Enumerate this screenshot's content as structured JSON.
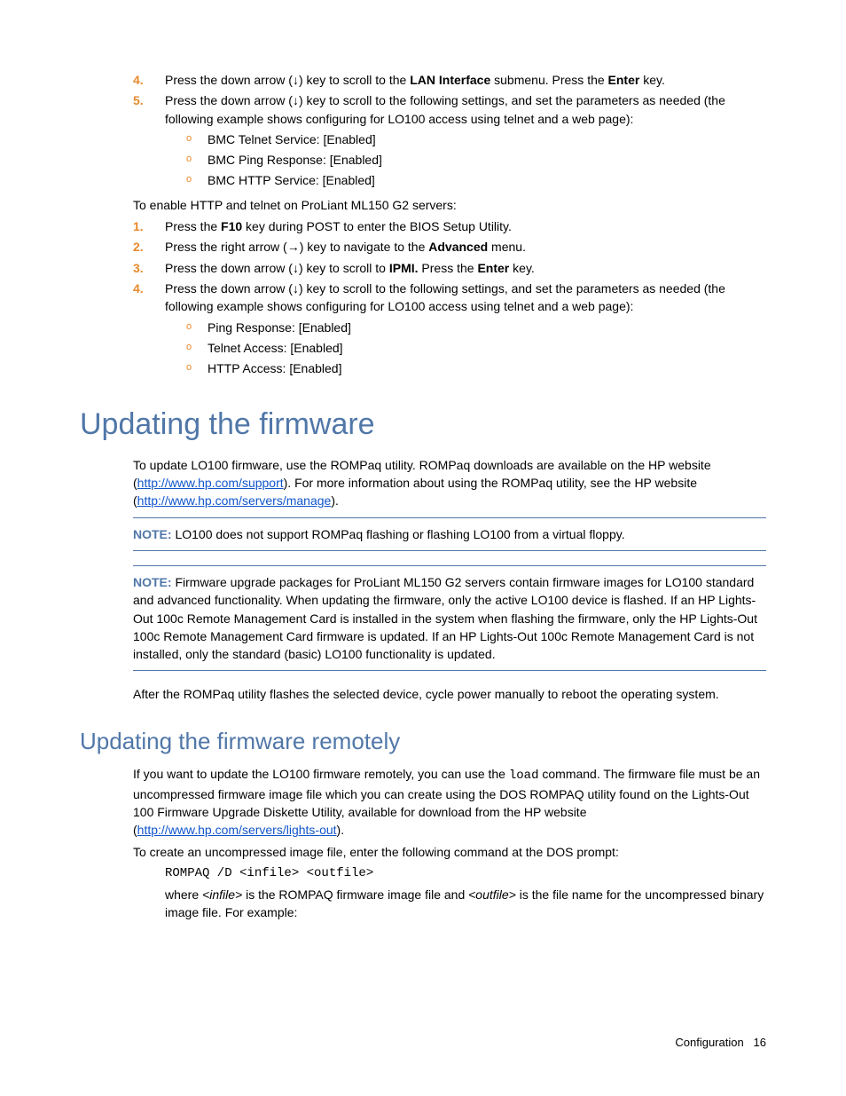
{
  "top_list": [
    {
      "num": "4.",
      "runs": [
        {
          "t": "Press the down arrow (↓) key to scroll to the "
        },
        {
          "t": "LAN Interface",
          "b": true
        },
        {
          "t": " submenu. Press the "
        },
        {
          "t": "Enter",
          "b": true
        },
        {
          "t": " key."
        }
      ]
    },
    {
      "num": "5.",
      "runs": [
        {
          "t": "Press the down arrow (↓) key to scroll to the following settings, and set the parameters as needed (the following example shows configuring for LO100 access using telnet and a web page):"
        }
      ],
      "bullets": [
        "BMC Telnet Service: [Enabled]",
        "BMC Ping Response: [Enabled]",
        "BMC HTTP Service: [Enabled]"
      ]
    }
  ],
  "mid_intro": "To enable HTTP and telnet on ProLiant ML150 G2 servers:",
  "mid_list": [
    {
      "num": "1.",
      "runs": [
        {
          "t": "Press the "
        },
        {
          "t": "F10",
          "b": true
        },
        {
          "t": " key during POST to enter the BIOS Setup Utility."
        }
      ]
    },
    {
      "num": "2.",
      "runs": [
        {
          "t": "Press the right arrow (→) key to navigate to the "
        },
        {
          "t": "Advanced",
          "b": true
        },
        {
          "t": " menu."
        }
      ]
    },
    {
      "num": "3.",
      "runs": [
        {
          "t": "Press the down arrow (↓) key to scroll to "
        },
        {
          "t": "IPMI.",
          "b": true
        },
        {
          "t": " Press the "
        },
        {
          "t": "Enter",
          "b": true
        },
        {
          "t": " key."
        }
      ]
    },
    {
      "num": "4.",
      "runs": [
        {
          "t": "Press the down arrow (↓) key to scroll to the following settings, and set the parameters as needed (the following example shows configuring for LO100 access using telnet and a web page):"
        }
      ],
      "bullets": [
        "Ping Response: [Enabled]",
        "Telnet Access: [Enabled]",
        "HTTP Access: [Enabled]"
      ]
    }
  ],
  "h1": "Updating the firmware",
  "fw_para_a": "To update LO100 firmware, use the ROMPaq utility. ROMPaq downloads are available on the HP website (",
  "fw_link1": "http://www.hp.com/support",
  "fw_para_b": "). For more information about using the ROMPaq utility, see the HP website (",
  "fw_link2": "http://www.hp.com/servers/manage",
  "fw_para_c": ").",
  "note1_label": "NOTE:",
  "note1_body": "  LO100 does not support ROMPaq flashing or flashing LO100 from a virtual floppy.",
  "note2_label": "NOTE:",
  "note2_body": "  Firmware upgrade packages for ProLiant ML150 G2 servers contain firmware images for LO100 standard and advanced functionality. When updating the firmware, only the active LO100 device is flashed. If an HP Lights-Out 100c Remote Management Card is installed in the system when flashing the firmware, only the HP Lights-Out 100c Remote Management Card firmware is updated. If an HP Lights-Out 100c Remote Management Card is not installed, only the standard (basic) LO100 functionality is updated.",
  "after_notes": "After the ROMPaq utility flashes the selected device, cycle power manually to reboot the operating system.",
  "h2": "Updating the firmware remotely",
  "remote_para_a": "If you want to update the LO100 firmware remotely, you can use the ",
  "remote_cmd": "load",
  "remote_para_b": " command. The firmware file must be an uncompressed firmware image file which you can create using the DOS ROMPAQ utility found on the Lights-Out 100 Firmware Upgrade Diskette Utility, available for download from the HP website (",
  "remote_link": "http://www.hp.com/servers/lights-out",
  "remote_para_c": ").",
  "create_intro": "To create an uncompressed image file, enter the following command at the DOS prompt:",
  "create_cmd": "ROMPAQ /D <infile> <outfile>",
  "where_a": "where ",
  "where_infile": "<infile>",
  "where_b": " is the ROMPAQ firmware image file and ",
  "where_outfile": "<outfile>",
  "where_c": " is the file name for the uncompressed binary image file. For example:",
  "footer_section": "Configuration",
  "footer_page": "16"
}
